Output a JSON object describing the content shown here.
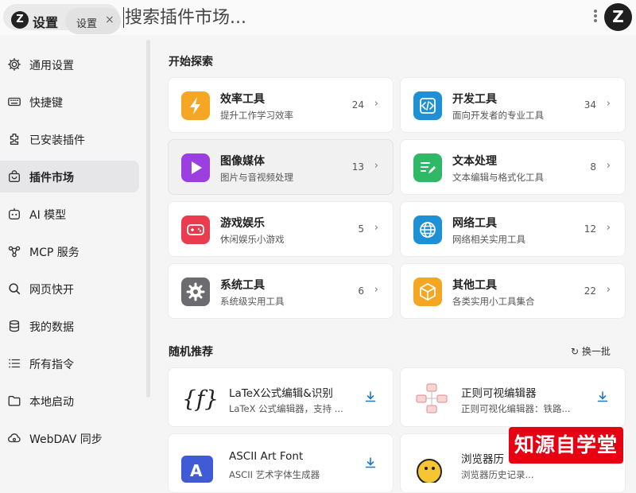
{
  "header": {
    "app_logo": "Z",
    "app_title": "设置",
    "tab_label": "设置",
    "tab_close": "×",
    "search_placeholder": "搜索插件市场...",
    "avatar": "Z"
  },
  "sidebar": {
    "items": [
      {
        "label": "通用设置",
        "icon": "gear-icon"
      },
      {
        "label": "快捷键",
        "icon": "keyboard-icon"
      },
      {
        "label": "已安装插件",
        "icon": "plugin-icon"
      },
      {
        "label": "插件市场",
        "icon": "shopping-bag-icon",
        "active": true
      },
      {
        "label": "AI 模型",
        "icon": "robot-icon"
      },
      {
        "label": "MCP 服务",
        "icon": "network-icon"
      },
      {
        "label": "网页快开",
        "icon": "search-icon"
      },
      {
        "label": "我的数据",
        "icon": "database-icon"
      },
      {
        "label": "所有指令",
        "icon": "list-icon"
      },
      {
        "label": "本地启动",
        "icon": "folder-icon"
      },
      {
        "label": "WebDAV 同步",
        "icon": "cloud-sync-icon"
      }
    ]
  },
  "explore": {
    "title": "开始探索",
    "categories": [
      {
        "name": "效率工具",
        "desc": "提升工作学习效率",
        "count": "24",
        "color": "#f5a623",
        "icon": "lightning-icon"
      },
      {
        "name": "开发工具",
        "desc": "面向开发者的专业工具",
        "count": "34",
        "color": "#1e90d6",
        "icon": "code-icon"
      },
      {
        "name": "图像媒体",
        "desc": "图片与音视频处理",
        "count": "13",
        "color": "#9b3fe0",
        "icon": "play-icon"
      },
      {
        "name": "文本处理",
        "desc": "文本编辑与格式化工具",
        "count": "8",
        "color": "#2fb865",
        "icon": "edit-icon"
      },
      {
        "name": "游戏娱乐",
        "desc": "休闲娱乐小游戏",
        "count": "5",
        "color": "#ea3b4f",
        "icon": "gamepad-icon"
      },
      {
        "name": "网络工具",
        "desc": "网络相关实用工具",
        "count": "12",
        "color": "#1e90d6",
        "icon": "globe-icon"
      },
      {
        "name": "系统工具",
        "desc": "系统级实用工具",
        "count": "6",
        "color": "#6b6b70",
        "icon": "settings-icon"
      },
      {
        "name": "其他工具",
        "desc": "各类实用小工具集合",
        "count": "22",
        "color": "#f5a623",
        "icon": "box-icon"
      }
    ],
    "chevron": "›"
  },
  "recommend": {
    "title": "随机推荐",
    "refresh_label": "换一批",
    "items": [
      {
        "name": "LaTeX公式编辑&识别",
        "desc": "LaTeX 公式编辑器，支持 ...",
        "icon": "function-icon"
      },
      {
        "name": "正则可视编辑器",
        "desc": "正则可视化编辑器：铁路...",
        "icon": "regex-diagram-icon"
      },
      {
        "name": "ASCII Art Font",
        "desc": "ASCII 艺术字体生成器",
        "icon": "font-a-icon"
      },
      {
        "name": "浏览器历",
        "desc": "浏览器历史记录...",
        "icon": "chick-icon"
      }
    ]
  },
  "watermark": "知源自学堂"
}
